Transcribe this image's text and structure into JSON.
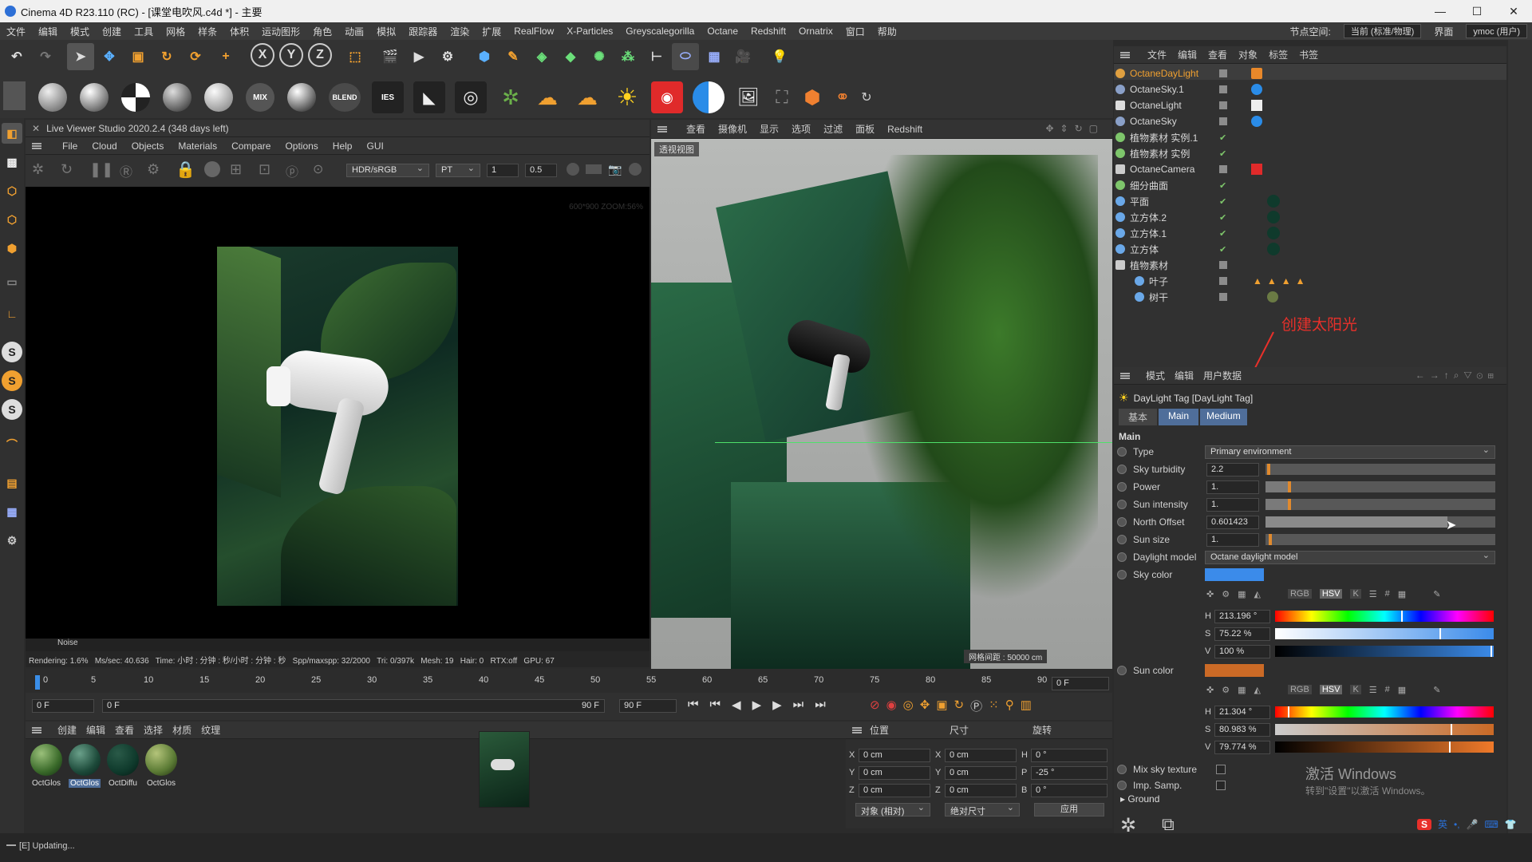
{
  "window": {
    "title": "Cinema 4D R23.110 (RC) - [课堂电吹风.c4d *] - 主要"
  },
  "menubar": {
    "items": [
      "文件",
      "编辑",
      "模式",
      "创建",
      "工具",
      "网格",
      "样条",
      "体积",
      "运动图形",
      "角色",
      "动画",
      "模拟",
      "跟踪器",
      "渲染",
      "扩展",
      "RealFlow",
      "X-Particles",
      "Greyscalegorilla",
      "Octane",
      "Redshift",
      "Ornatrix",
      "窗口",
      "帮助"
    ],
    "node_space_label": "节点空间:",
    "node_space_value": "当前 (标准/物理)",
    "interface_label": "界面",
    "interface_value": "ymoc (用户)"
  },
  "toolbar1": {
    "x_label": "X",
    "y_label": "Y",
    "z_label": "Z"
  },
  "toolbar2": {
    "mix_label": "MIX",
    "blend_label": "BLEND",
    "ies_label": "IES"
  },
  "live_viewer": {
    "title": "Live Viewer Studio 2020.2.4 (348 days left)",
    "menu": [
      "File",
      "Cloud",
      "Objects",
      "Materials",
      "Compare",
      "Options",
      "Help",
      "GUI"
    ],
    "color_mode": "HDR/sRGB",
    "kernel": "PT",
    "value1": "1",
    "value2": "0.5",
    "corner_info": "600*900 ZOOM:56%",
    "noise_label": "Noise",
    "status": "Rendering: 1.6%   Ms/sec: 40.636   Time: 小时 : 分钟 : 秒/小时 : 分钟 : 秒   Spp/maxspp: 32/2000   Tri: 0/397k   Mesh: 19   Hair: 0   RTX:off   GPU: 67"
  },
  "viewport": {
    "menu": [
      "查看",
      "摄像机",
      "显示",
      "选项",
      "过滤",
      "面板",
      "Redshift"
    ],
    "label": "透视视图",
    "grid_info": "网格间距 : 50000 cm"
  },
  "object_manager": {
    "menu": [
      "文件",
      "编辑",
      "查看",
      "对象",
      "标签",
      "书签"
    ],
    "objects": [
      {
        "name": "OctaneDayLight",
        "color": "#e0a040"
      },
      {
        "name": "OctaneSky.1",
        "color": "#8aa0c8"
      },
      {
        "name": "OctaneLight",
        "color": "#dddddd"
      },
      {
        "name": "OctaneSky",
        "color": "#8aa0c8"
      },
      {
        "name": "植物素材 实例.1",
        "color": "#7ec66b"
      },
      {
        "name": "植物素材 实例",
        "color": "#7ec66b"
      },
      {
        "name": "OctaneCamera",
        "color": "#cccccc"
      },
      {
        "name": "细分曲面",
        "color": "#7ec66b"
      },
      {
        "name": "平面",
        "color": "#6aa8e8"
      },
      {
        "name": "立方体.2",
        "color": "#6aa8e8"
      },
      {
        "name": "立方体.1",
        "color": "#6aa8e8"
      },
      {
        "name": "立方体",
        "color": "#6aa8e8"
      },
      {
        "name": "植物素材",
        "color": "#cccccc"
      },
      {
        "name": "叶子",
        "color": "#6aa8e8"
      },
      {
        "name": "树干",
        "color": "#6aa8e8"
      }
    ],
    "annotation": "创建太阳光"
  },
  "attributes": {
    "menu": [
      "模式",
      "编辑",
      "用户数据"
    ],
    "tag_title": "DayLight Tag [DayLight Tag]",
    "tabs": [
      "基本",
      "Main",
      "Medium"
    ],
    "section": "Main",
    "type_label": "Type",
    "type_value": "Primary environment",
    "sky_turbidity_label": "Sky turbidity",
    "sky_turbidity_value": "2.2",
    "power_label": "Power",
    "power_value": "1.",
    "sun_intensity_label": "Sun intensity",
    "sun_intensity_value": "1.",
    "north_offset_label": "North Offset",
    "north_offset_value": "0.601423",
    "sun_size_label": "Sun size",
    "sun_size_value": "1.",
    "daylight_model_label": "Daylight model",
    "daylight_model_value": "Octane daylight model",
    "sky_color_label": "Sky color",
    "sky_color": "#3b8bea",
    "sky_h": "213.196 °",
    "sky_s": "75.22 %",
    "sky_v": "100 %",
    "sun_color_label": "Sun color",
    "sun_color": "#cb6a26",
    "sun_h": "21.304 °",
    "sun_s": "80.983 %",
    "sun_v": "79.774 %",
    "rgb_label": "RGB",
    "hsv_label": "HSV",
    "k_label": "K",
    "mix_sky_label": "Mix sky texture",
    "imp_samp_label": "Imp. Samp.",
    "ground_label": "Ground",
    "h": "H",
    "s": "S",
    "v": "V"
  },
  "timeline": {
    "ticks": [
      "0",
      "5",
      "10",
      "15",
      "20",
      "25",
      "30",
      "35",
      "40",
      "45",
      "50",
      "55",
      "60",
      "65",
      "70",
      "75",
      "80",
      "85",
      "90"
    ],
    "frame_end_box": "0 F",
    "start": "0 F",
    "current": "0 F",
    "end1": "90 F",
    "end2": "90 F"
  },
  "materials": {
    "menu": [
      "创建",
      "编辑",
      "查看",
      "选择",
      "材质",
      "纹理"
    ],
    "items": [
      {
        "name": "OctGlos",
        "color": "#3a6a2a"
      },
      {
        "name": "OctGlos",
        "color": "#1d4a3a"
      },
      {
        "name": "OctDiffu",
        "color": "#0f3a2c"
      },
      {
        "name": "OctGlos",
        "color": "#5a7a34"
      }
    ]
  },
  "coords": {
    "headers": [
      "位置",
      "尺寸",
      "旋转"
    ],
    "pos": [
      {
        "axis": "X",
        "val": "0 cm"
      },
      {
        "axis": "Y",
        "val": "0 cm"
      },
      {
        "axis": "Z",
        "val": "0 cm"
      }
    ],
    "size": [
      {
        "axis": "X",
        "val": "0 cm"
      },
      {
        "axis": "Y",
        "val": "0 cm"
      },
      {
        "axis": "Z",
        "val": "0 cm"
      }
    ],
    "rot": [
      {
        "axis": "H",
        "val": "0 °"
      },
      {
        "axis": "P",
        "val": "-25 °"
      },
      {
        "axis": "B",
        "val": "0 °"
      }
    ],
    "mode1": "对象 (相对)",
    "mode2": "绝对尺寸",
    "apply": "应用"
  },
  "statusbar": {
    "text": "[E]  Updating..."
  },
  "watermark": {
    "line1": "激活 Windows",
    "line2": "转到\"设置\"以激活 Windows。"
  },
  "tray": {
    "ime": "英"
  }
}
